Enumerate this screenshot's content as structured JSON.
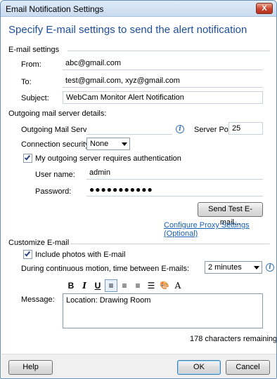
{
  "window": {
    "title": "Email Notification Settings",
    "close_glyph": "X"
  },
  "heading": "Specify E-mail settings to send the alert notification",
  "email_settings": {
    "section_label": "E-mail settings",
    "from_label": "From:",
    "from_value": "abc@gmail.com",
    "to_label": "To:",
    "to_value": "test@gmail.com, xyz@gmail.com",
    "subject_label": "Subject:",
    "subject_value": "WebCam Monitor Alert Notification"
  },
  "server": {
    "section_label": "Outgoing mail server details:",
    "server_label": "Outgoing Mail Server:",
    "server_value": "",
    "info_glyph": "i",
    "port_label": "Server Port:",
    "port_value": "25",
    "security_label": "Connection security:",
    "security_value": "None",
    "auth_checkbox_label": "My outgoing server requires authentication",
    "auth_checked": true,
    "username_label": "User name:",
    "username_value": "admin",
    "password_label": "Password:",
    "password_value": "●●●●●●●●●●●",
    "test_button": "Send Test E-mail...",
    "proxy_link": "Configure Proxy Settings (Optional)"
  },
  "customize": {
    "section_label": "Customize E-mail",
    "include_photos_label": "Include photos with E-mail",
    "include_photos_checked": true,
    "interval_label": "During continuous motion, time between E-mails:",
    "interval_value": "2 minutes",
    "info_glyph": "i",
    "toolbar": {
      "bold": "B",
      "italic": "I",
      "underline": "U",
      "align_left": "≡",
      "align_center": "≡",
      "align_right": "≡",
      "bullets": "☰",
      "color": "🎨",
      "font": "A"
    },
    "message_label": "Message:",
    "message_value": "Location: Drawing Room",
    "chars_remaining": "178 characters remaining"
  },
  "footer": {
    "help": "Help",
    "ok": "OK",
    "cancel": "Cancel"
  },
  "colors": {
    "heading": "#1e4f9c",
    "link": "#1a5fb4",
    "close": "#c8452f"
  }
}
